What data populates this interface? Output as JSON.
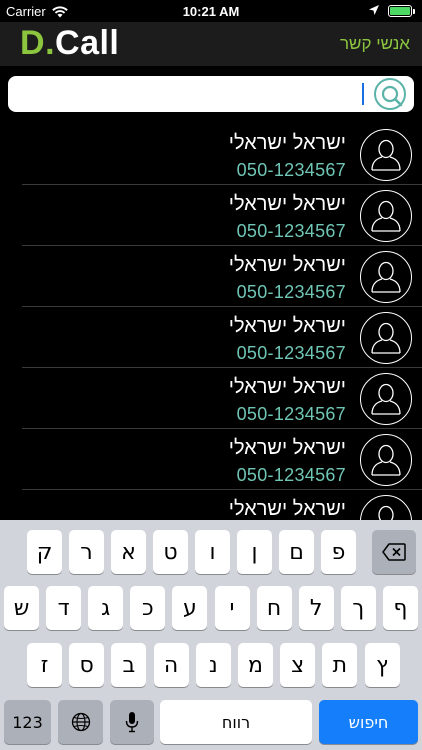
{
  "status_bar": {
    "carrier": "Carrier",
    "time": "10:21 AM",
    "battery_color": "#4cd964"
  },
  "header": {
    "logo_d": "D",
    "logo_dot": ".",
    "logo_call": "Call",
    "title": "אנשי קשר",
    "accent_color": "#8cc63f"
  },
  "search": {
    "value": "",
    "placeholder": "",
    "button_icon": "search-icon"
  },
  "contacts": [
    {
      "name": "ישראל ישראלי",
      "phone": "050-1234567"
    },
    {
      "name": "ישראל ישראלי",
      "phone": "050-1234567"
    },
    {
      "name": "ישראל ישראלי",
      "phone": "050-1234567"
    },
    {
      "name": "ישראל ישראלי",
      "phone": "050-1234567"
    },
    {
      "name": "ישראל ישראלי",
      "phone": "050-1234567"
    },
    {
      "name": "ישראל ישראלי",
      "phone": "050-1234567"
    },
    {
      "name": "ישראל ישראלי",
      "phone": ""
    }
  ],
  "keyboard": {
    "row1": [
      "ק",
      "ר",
      "א",
      "ט",
      "ו",
      "ן",
      "ם",
      "פ"
    ],
    "row2": [
      "ש",
      "ד",
      "ג",
      "כ",
      "ע",
      "י",
      "ח",
      "ל",
      "ך",
      "ף"
    ],
    "row3": [
      "ז",
      "ס",
      "ב",
      "ה",
      "נ",
      "מ",
      "צ",
      "ת",
      "ץ"
    ],
    "numbers_label": "123",
    "space_label": "רווח",
    "search_label": "חיפוש",
    "backspace_icon": "backspace-icon",
    "globe_icon": "globe-icon",
    "mic_icon": "microphone-icon"
  }
}
